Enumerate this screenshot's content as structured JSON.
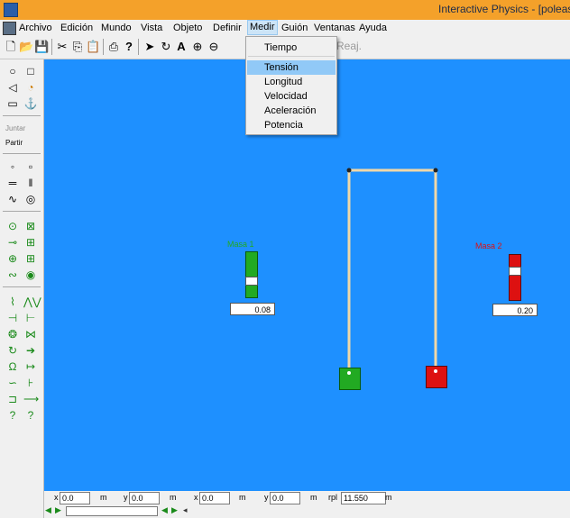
{
  "window": {
    "title": "Interactive Physics - [poleas"
  },
  "menubar": {
    "items": [
      "Archivo",
      "Edición",
      "Mundo",
      "Vista",
      "Objeto",
      "Definir",
      "Medir",
      "Guión",
      "Ventanas",
      "Ayuda"
    ],
    "active": "Medir"
  },
  "toolbar": {
    "reaj_label": "Reaj."
  },
  "medir_menu": {
    "items": [
      "Tiempo",
      "Tensión",
      "Longitud",
      "Velocidad",
      "Aceleración",
      "Potencia"
    ],
    "highlighted": "Tensión"
  },
  "palette": {
    "juntar_label": "Juntar",
    "partir_label": "Partir"
  },
  "canvas": {
    "background": "#1e90ff",
    "masa1": {
      "label": "Masa 1",
      "value": "0.08",
      "color": "#22aa22"
    },
    "masa2": {
      "label": "Masa 2",
      "value": "0.20",
      "color": "#dd1111"
    }
  },
  "statusbar": {
    "x1_label": "x",
    "x1_value": "0.0",
    "x1_unit": "m",
    "y1_label": "y",
    "y1_value": "0.0",
    "y1_unit": "m",
    "x2_label": "x",
    "x2_value": "0.0",
    "x2_unit": "m",
    "y2_label": "y",
    "y2_value": "0.0",
    "y2_unit": "m",
    "rpl_label": "rpl",
    "rpl_value": "11.550",
    "rpl_unit": "m"
  }
}
